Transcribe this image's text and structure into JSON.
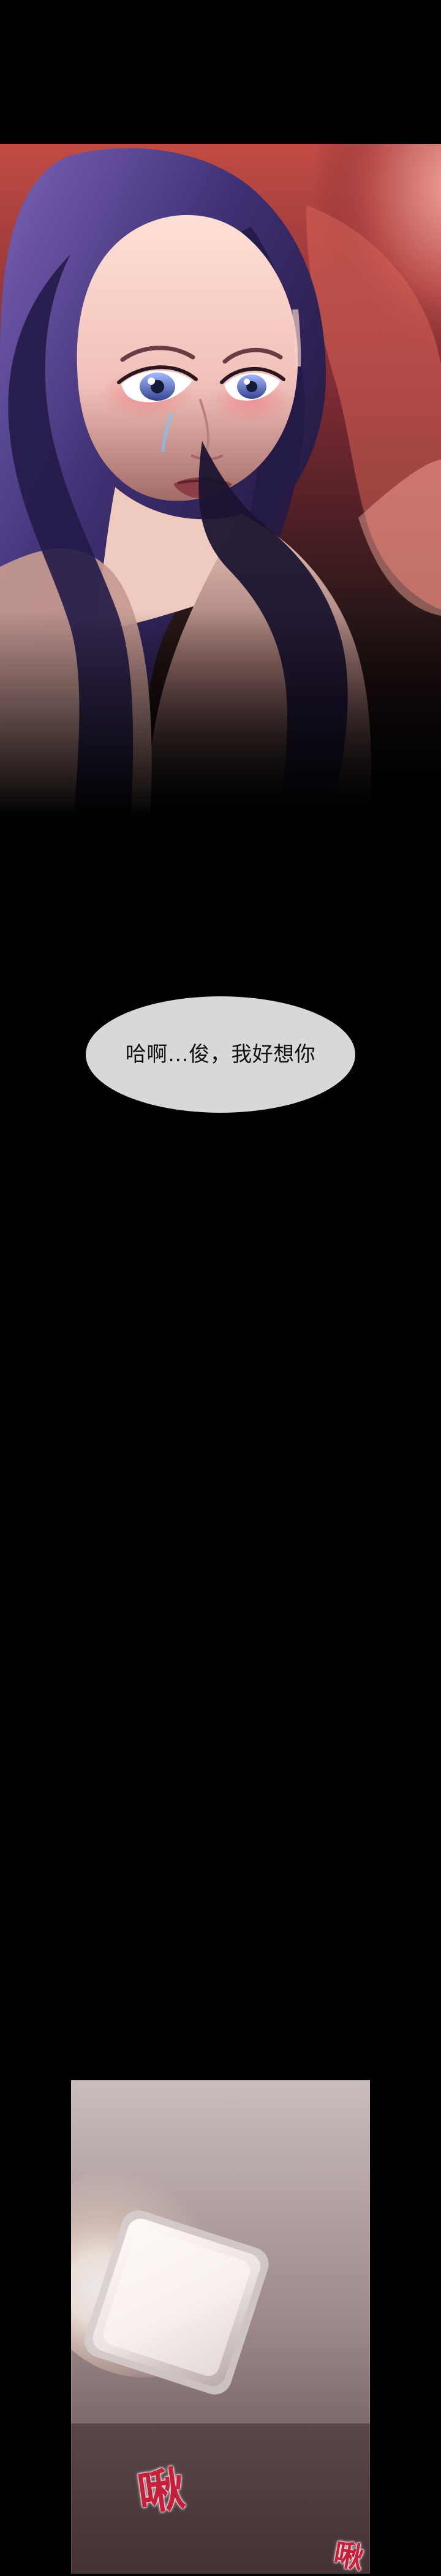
{
  "dialogue": {
    "speech": "哈啊…俊，我好想你"
  },
  "sound_effects": {
    "main": "啾",
    "small": "啾"
  },
  "colors": {
    "background": "#000000",
    "bubble": "#d8d8d8",
    "bubble_text": "#111111",
    "sfx": "#c71f39"
  }
}
